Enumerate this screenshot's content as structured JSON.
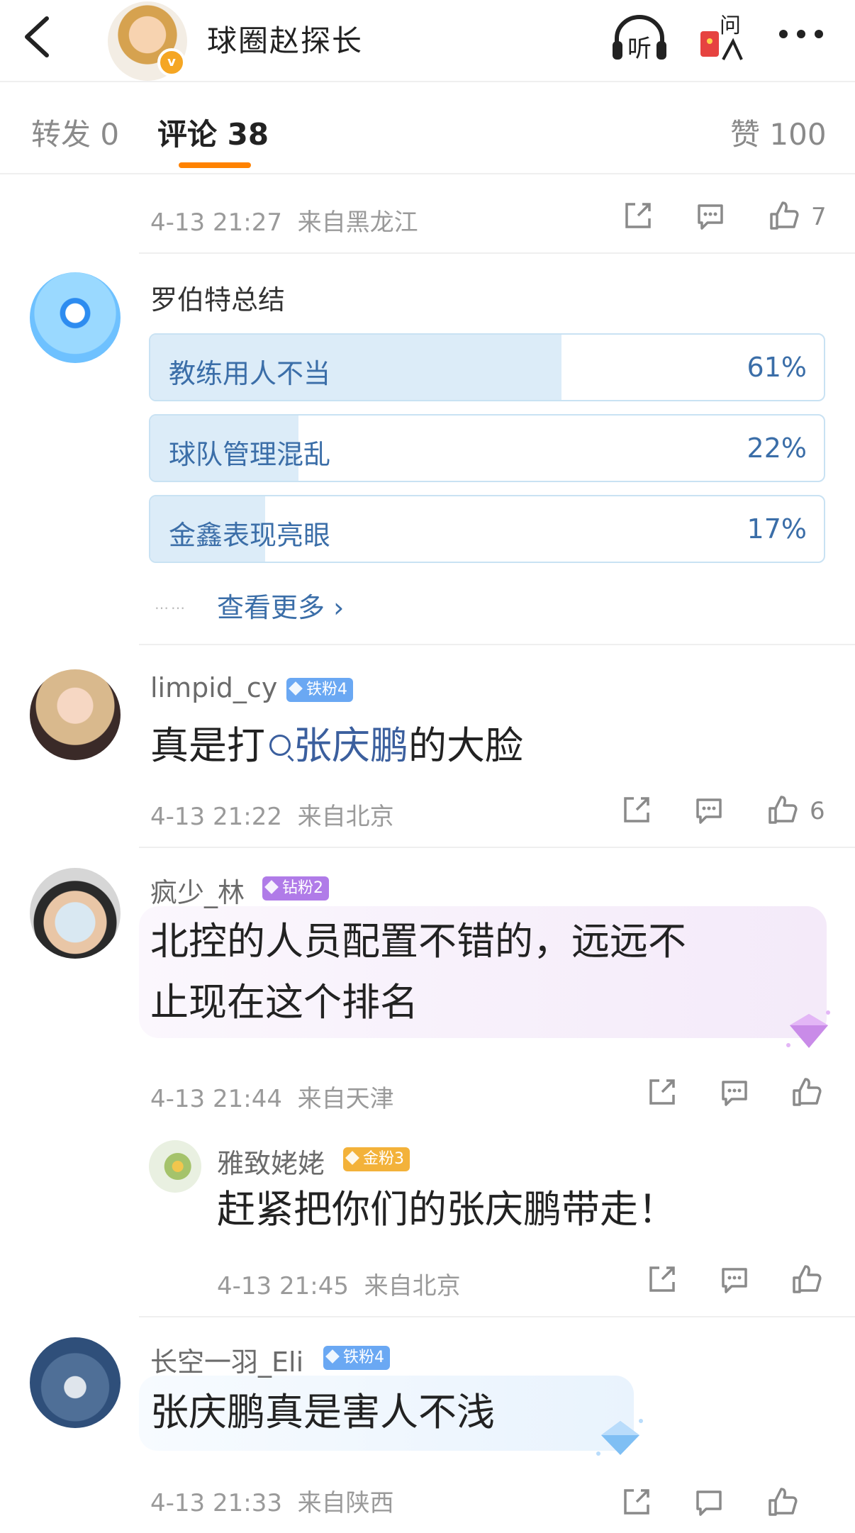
{
  "header": {
    "title": "球圈赵探长",
    "verified_mark": "v",
    "listen_label": "听",
    "ask_label": "问"
  },
  "tabs": [
    {
      "label": "转发",
      "count": "0"
    },
    {
      "label": "评论",
      "count": "38"
    },
    {
      "label": "赞",
      "count": "100"
    }
  ],
  "post_meta": {
    "time": "4-13 21:27",
    "location": "来自黑龙江",
    "likes": "7"
  },
  "poll": {
    "title": "罗伯特总结",
    "options": [
      {
        "label": "教练用人不当",
        "percent": "61%",
        "value": 61
      },
      {
        "label": "球队管理混乱",
        "percent": "22%",
        "value": 22
      },
      {
        "label": "金鑫表现亮眼",
        "percent": "17%",
        "value": 17
      }
    ],
    "dots": "……",
    "more_label": "查看更多 ›"
  },
  "comments": [
    {
      "user": "limpid_cy",
      "badge": "铁粉4",
      "text_before": "真是打",
      "link": "张庆鹏",
      "text_after": "的大脸",
      "time": "4-13 21:22",
      "location": "来自北京",
      "likes": "6"
    },
    {
      "user": "疯少_林",
      "badge": "钻粉2",
      "line1": "北控的人员配置不错的，远远不",
      "line2": "止现在这个排名",
      "time": "4-13 21:44",
      "location": "来自天津",
      "reply": {
        "user": "雅致姥姥",
        "badge": "金粉3",
        "text": "赶紧把你们的张庆鹏带走！",
        "time": "4-13 21:45",
        "location": "来自北京"
      }
    },
    {
      "user": "长空一羽_Eli",
      "badge": "铁粉4",
      "text": "张庆鹏真是害人不浅",
      "time": "4-13 21:33",
      "location": "来自陕西"
    }
  ],
  "colors": {
    "accent": "#ff8200",
    "link": "#3b5f9e",
    "poll_fill": "#dcecf8",
    "badge_iron": "#6aa8f3",
    "badge_drill": "#b07be8",
    "badge_gold": "#f3b23a"
  },
  "icons": [
    "back-arrow-icon",
    "headphones-icon",
    "red-envelope-icon",
    "more-icon",
    "share-icon",
    "comment-icon",
    "like-icon",
    "search-icon",
    "diamond-decoration-icon"
  ]
}
